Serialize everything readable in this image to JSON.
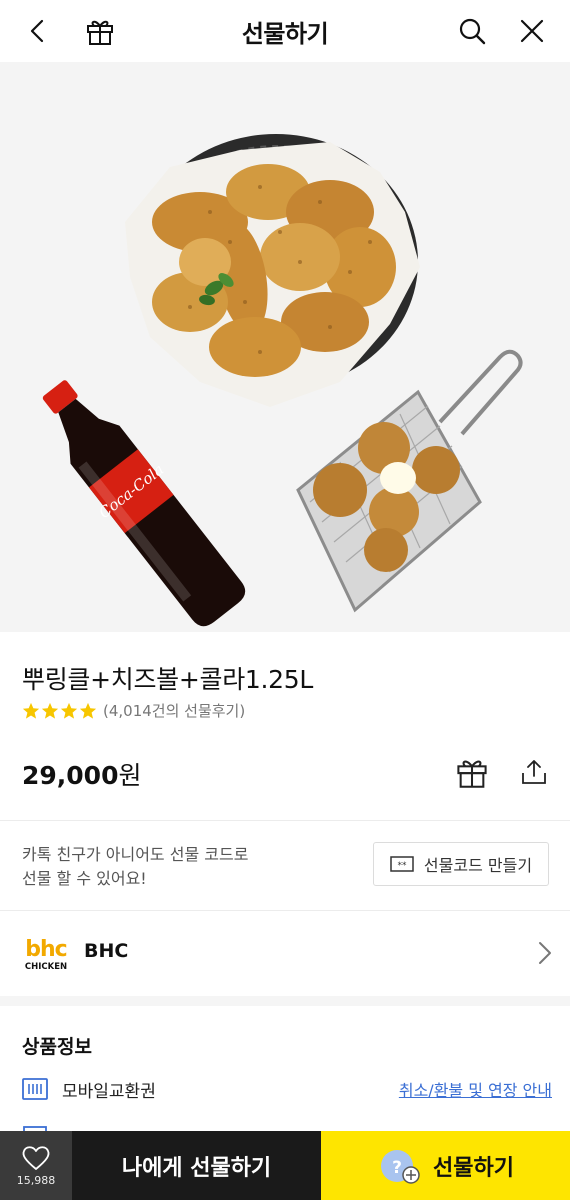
{
  "header": {
    "title": "선물하기"
  },
  "product": {
    "title": "뿌링클+치즈볼+콜라1.25L",
    "rating_stars": 4,
    "review_text": "(4,014건의 선물후기)",
    "price_number": "29,000",
    "price_unit": "원",
    "image_brand_text": "Coca-Cola"
  },
  "gift_code": {
    "desc_line1": "카톡 친구가 아니어도 선물 코드로",
    "desc_line2": "선물 할 수 있어요!",
    "button_label": "선물코드 만들기"
  },
  "brand": {
    "logo_text_top": "bhc",
    "logo_text_bottom": "CHICKEN",
    "name": "BHC"
  },
  "product_info": {
    "section_title": "상품정보",
    "rows": [
      {
        "label": "모바일교환권",
        "link": "취소/환불 및 연장 안내",
        "icon": "barcode-icon"
      }
    ]
  },
  "bottom_bar": {
    "like_count": "15,988",
    "self_gift_label": "나에게 선물하기",
    "gift_label": "선물하기"
  },
  "colors": {
    "accent_yellow": "#fee500",
    "link_blue": "#3b6fd4",
    "star_yellow": "#f7c600",
    "dark_bar": "#1a1a1a"
  }
}
